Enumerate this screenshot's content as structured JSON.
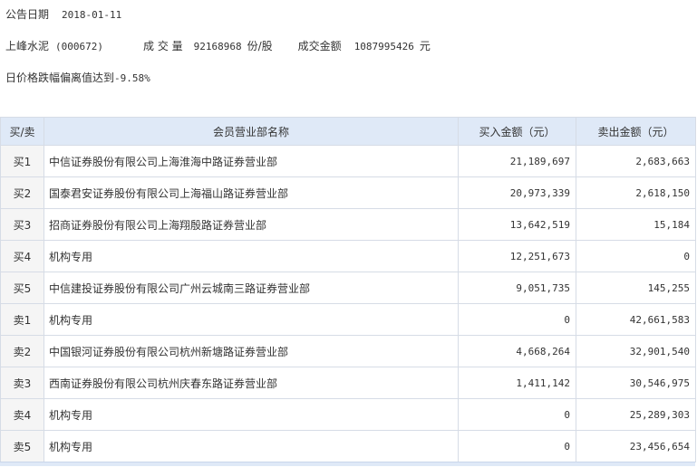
{
  "header": {
    "date_label": "公告日期",
    "date_value": "2018-01-11",
    "stock_name": "上峰水泥",
    "stock_code": "(000672)",
    "volume_label": "成 交 量",
    "volume_value": "92168968",
    "volume_unit": "份/股",
    "amount_label": "成交金额",
    "amount_value": "1087995426",
    "amount_unit": "元",
    "reason_text": "日价格跌幅偏离值达到",
    "reason_value": "-9.58%"
  },
  "table": {
    "columns": [
      "买/卖",
      "会员营业部名称",
      "买入金额（元）",
      "卖出金额（元）"
    ],
    "rows": [
      {
        "side": "买1",
        "name": "中信证券股份有限公司上海淮海中路证券营业部",
        "buy": "21,189,697",
        "sell": "2,683,663"
      },
      {
        "side": "买2",
        "name": "国泰君安证券股份有限公司上海福山路证券营业部",
        "buy": "20,973,339",
        "sell": "2,618,150"
      },
      {
        "side": "买3",
        "name": "招商证券股份有限公司上海翔殷路证券营业部",
        "buy": "13,642,519",
        "sell": "15,184"
      },
      {
        "side": "买4",
        "name": "机构专用",
        "buy": "12,251,673",
        "sell": "0"
      },
      {
        "side": "买5",
        "name": "中信建投证券股份有限公司广州云城南三路证券营业部",
        "buy": "9,051,735",
        "sell": "145,255"
      },
      {
        "side": "卖1",
        "name": "机构专用",
        "buy": "0",
        "sell": "42,661,583"
      },
      {
        "side": "卖2",
        "name": "中国银河证券股份有限公司杭州新塘路证券营业部",
        "buy": "4,668,264",
        "sell": "32,901,540"
      },
      {
        "side": "卖3",
        "name": "西南证券股份有限公司杭州庆春东路证券营业部",
        "buy": "1,411,142",
        "sell": "30,546,975"
      },
      {
        "side": "卖4",
        "name": "机构专用",
        "buy": "0",
        "sell": "25,289,303"
      },
      {
        "side": "卖5",
        "name": "机构专用",
        "buy": "0",
        "sell": "23,456,654"
      }
    ]
  }
}
